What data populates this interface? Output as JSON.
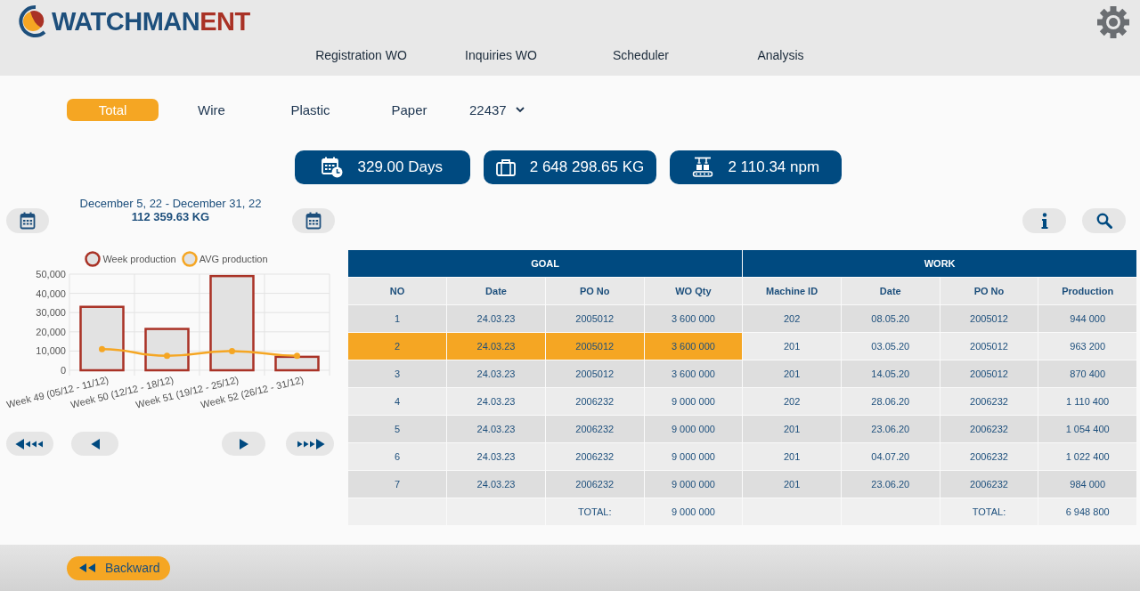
{
  "header": {
    "logo": {
      "text": "WATCHMAN",
      "accent": "ENT"
    },
    "nav": [
      {
        "label": "Registration WO"
      },
      {
        "label": "Inquiries WO"
      },
      {
        "label": "Scheduler"
      },
      {
        "label": "Analysis"
      }
    ]
  },
  "tabs": [
    {
      "label": "Total",
      "selected": true
    },
    {
      "label": "Wire",
      "selected": false
    },
    {
      "label": "Plastic",
      "selected": false
    },
    {
      "label": "Paper",
      "selected": false
    }
  ],
  "dropdown": {
    "value": "22437"
  },
  "stats": [
    {
      "kind": "days",
      "value": "329.00 Days"
    },
    {
      "kind": "weight",
      "value": "2 648 298.65 KG"
    },
    {
      "kind": "speed",
      "value": "2 110.34 npm"
    }
  ],
  "period": {
    "range": "December 5, 22 - December 31, 22",
    "total": "112 359.63 KG"
  },
  "chart_data": {
    "type": "bar",
    "categories": [
      "Week 49 (05/12 - 11/12)",
      "Week 50 (12/12 - 18/12)",
      "Week 51 (19/12 - 25/12)",
      "Week 52 (26/12 - 31/12)"
    ],
    "series": [
      {
        "name": "Week production",
        "type": "bar",
        "color": "#a93226",
        "values": [
          33000,
          21500,
          49000,
          7000
        ]
      },
      {
        "name": "AVG production",
        "type": "line",
        "color": "#f5a623",
        "marker": "circle",
        "values": [
          11000,
          7500,
          10000,
          7500
        ]
      }
    ],
    "stacked": false,
    "grid": true,
    "ylim": [
      0,
      50000
    ],
    "yticks": [
      {
        "value": 0,
        "label": "0"
      },
      {
        "value": 10000,
        "label": "10,000"
      },
      {
        "value": 20000,
        "label": "20,000"
      },
      {
        "value": 30000,
        "label": "30,000"
      },
      {
        "value": 40000,
        "label": "40,000"
      },
      {
        "value": 50000,
        "label": "50,000"
      }
    ]
  },
  "table": {
    "groups": [
      {
        "title": "GOAL",
        "columns": [
          "NO",
          "Date",
          "PO No",
          "WO Qty"
        ]
      },
      {
        "title": "WORK",
        "columns": [
          "Machine ID",
          "Date",
          "PO No",
          "Production"
        ]
      }
    ],
    "rows": [
      {
        "selected": false,
        "goal": [
          "1",
          "24.03.23",
          "2005012",
          "3 600 000"
        ],
        "work": [
          "202",
          "08.05.20",
          "2005012",
          "944 000"
        ]
      },
      {
        "selected": true,
        "goal": [
          "2",
          "24.03.23",
          "2005012",
          "3 600 000"
        ],
        "work": [
          "201",
          "03.05.20",
          "2005012",
          "963 200"
        ]
      },
      {
        "selected": false,
        "goal": [
          "3",
          "24.03.23",
          "2005012",
          "3 600 000"
        ],
        "work": [
          "201",
          "14.05.20",
          "2005012",
          "870 400"
        ]
      },
      {
        "selected": false,
        "goal": [
          "4",
          "24.03.23",
          "2006232",
          "9 000 000"
        ],
        "work": [
          "202",
          "28.06.20",
          "2006232",
          "1 110 400"
        ]
      },
      {
        "selected": false,
        "goal": [
          "5",
          "24.03.23",
          "2006232",
          "9 000 000"
        ],
        "work": [
          "201",
          "23.06.20",
          "2006232",
          "1 054 400"
        ]
      },
      {
        "selected": false,
        "goal": [
          "6",
          "24.03.23",
          "2006232",
          "9 000 000"
        ],
        "work": [
          "201",
          "04.07.20",
          "2006232",
          "1 022 400"
        ]
      },
      {
        "selected": false,
        "goal": [
          "7",
          "24.03.23",
          "2006232",
          "9 000 000"
        ],
        "work": [
          "201",
          "23.06.20",
          "2006232",
          "984 000"
        ]
      }
    ],
    "totals": {
      "goal_label": "TOTAL:",
      "goal_value": "9 000 000",
      "work_label": "TOTAL:",
      "work_value": "6 948 800"
    }
  },
  "footer": {
    "back_button": "Backward"
  }
}
